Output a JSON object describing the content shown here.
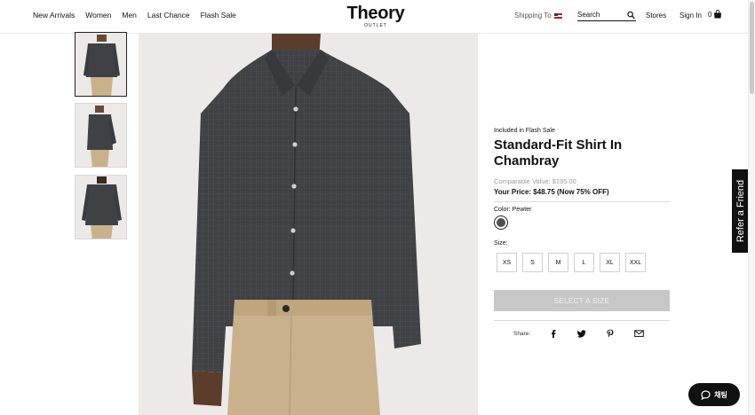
{
  "header": {
    "nav": [
      "New Arrivals",
      "Women",
      "Men",
      "Last Chance",
      "Flash Sale"
    ],
    "logo": "Theory",
    "logo_sub": "OUTLET",
    "shipping_label": "Shipping To",
    "search_placeholder": "Search",
    "stores": "Stores",
    "sign_in": "Sign In",
    "cart_count": "0"
  },
  "product": {
    "badge": "Included in Flash Sale",
    "title": "Standard-Fit Shirt In Chambray",
    "comparable_value": "Comparable Value: $195.00",
    "your_price": "Your Price: $48.75 (Now 75% OFF)",
    "color_label": "Color:",
    "color_value": "Pewter",
    "color_hex": "#4e4f52",
    "size_label": "Size:",
    "sizes": [
      "XS",
      "S",
      "M",
      "L",
      "XL",
      "XXL"
    ],
    "cta": "SELECT A SIZE",
    "share_label": "Share:",
    "share_icons": [
      "facebook-icon",
      "twitter-icon",
      "pinterest-icon",
      "email-icon"
    ]
  },
  "refer": "Refer a Friend",
  "chat": "채팅",
  "colors": {
    "shirt": "#3f4145",
    "pants": "#c9b18c",
    "image_bg": "#eceae8",
    "cta_disabled": "#c7c7c7"
  }
}
